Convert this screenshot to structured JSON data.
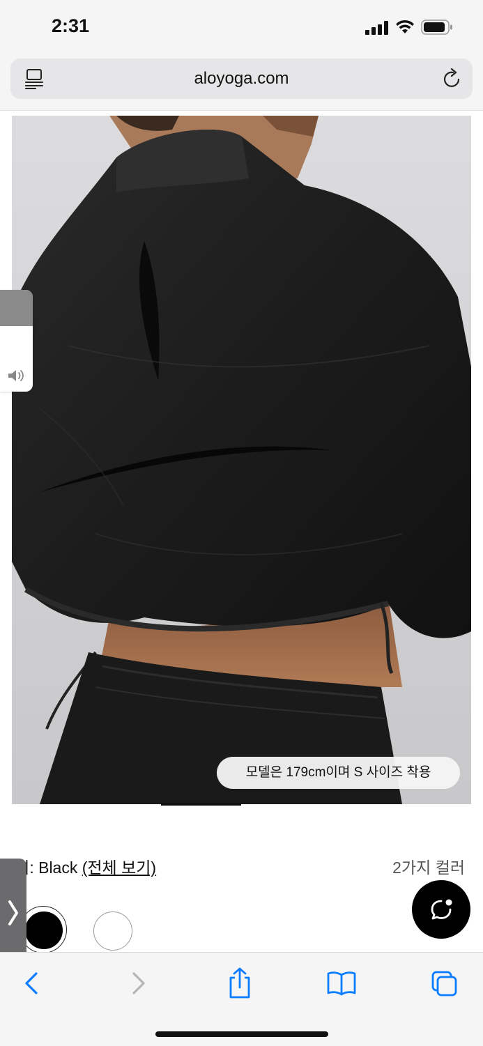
{
  "status_bar": {
    "time": "2:31"
  },
  "address_bar": {
    "url": "aloyoga.com"
  },
  "product_image": {
    "caption": "모델은 179cm이며 S 사이즈 착용"
  },
  "color_selector": {
    "label_prefix": "코어: Black ",
    "view_all_link": "(전체 보기)",
    "count": "2가지 컬러",
    "swatches": [
      {
        "name": "Black",
        "color": "#000000",
        "selected": true
      },
      {
        "name": "White",
        "color": "#ffffff",
        "selected": false
      }
    ]
  },
  "icons": {
    "reader": "reader-icon",
    "reload": "reload-icon",
    "volume": "speaker-icon",
    "chat": "chat-bubble-icon",
    "side_tab": "chevron-right-icon",
    "back": "chevron-left-icon",
    "forward": "chevron-right-icon",
    "share": "share-icon",
    "bookmarks": "book-icon",
    "tabs": "tabs-icon"
  },
  "colors": {
    "accent": "#0a7cff",
    "disabled": "#b5b5b8"
  }
}
